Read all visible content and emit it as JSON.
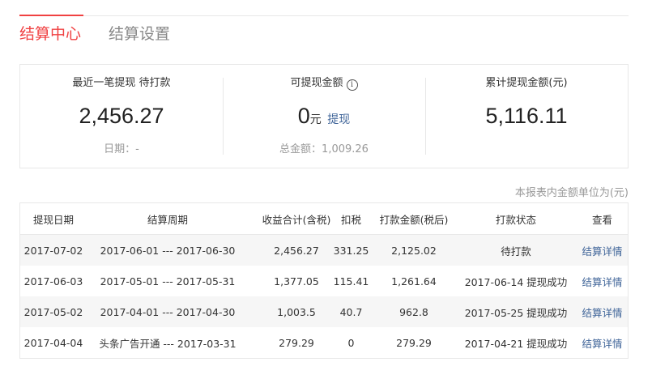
{
  "tabs": [
    {
      "label": "结算中心",
      "active": true
    },
    {
      "label": "结算设置",
      "active": false
    }
  ],
  "summary": {
    "latest": {
      "label": "最近一笔提现 待打款",
      "value": "2,456.27",
      "sub": "日期：-"
    },
    "available": {
      "label": "可提现金额",
      "info_icon": "info-icon",
      "value": "0",
      "unit": "元",
      "action": "提现",
      "sub": "总金额：1,009.26"
    },
    "cumulative": {
      "label": "累计提现金额(元)",
      "value": "5,116.11"
    }
  },
  "unit_note": "本报表内金额单位为(元)",
  "table": {
    "headers": [
      "提现日期",
      "结算周期",
      "收益合计(含税)",
      "扣税",
      "打款金额(税后)",
      "打款状态",
      "查看"
    ],
    "rows": [
      {
        "date": "2017-07-02",
        "period": "2017-06-01 --- 2017-06-30",
        "income": "2,456.27",
        "tax": "331.25",
        "payout": "2,125.02",
        "status": "待打款",
        "view": "结算详情"
      },
      {
        "date": "2017-06-03",
        "period": "2017-05-01 --- 2017-05-31",
        "income": "1,377.05",
        "tax": "115.41",
        "payout": "1,261.64",
        "status": "2017-06-14 提现成功",
        "view": "结算详情"
      },
      {
        "date": "2017-05-02",
        "period": "2017-04-01 --- 2017-04-30",
        "income": "1,003.5",
        "tax": "40.7",
        "payout": "962.8",
        "status": "2017-05-25 提现成功",
        "view": "结算详情"
      },
      {
        "date": "2017-04-04",
        "period": "头条广告开通 --- 2017-03-31",
        "income": "279.29",
        "tax": "0",
        "payout": "279.29",
        "status": "2017-04-21 提现成功",
        "view": "结算详情"
      }
    ]
  },
  "colors": {
    "accent": "#f04142",
    "link": "#406599",
    "muted": "#999999"
  }
}
